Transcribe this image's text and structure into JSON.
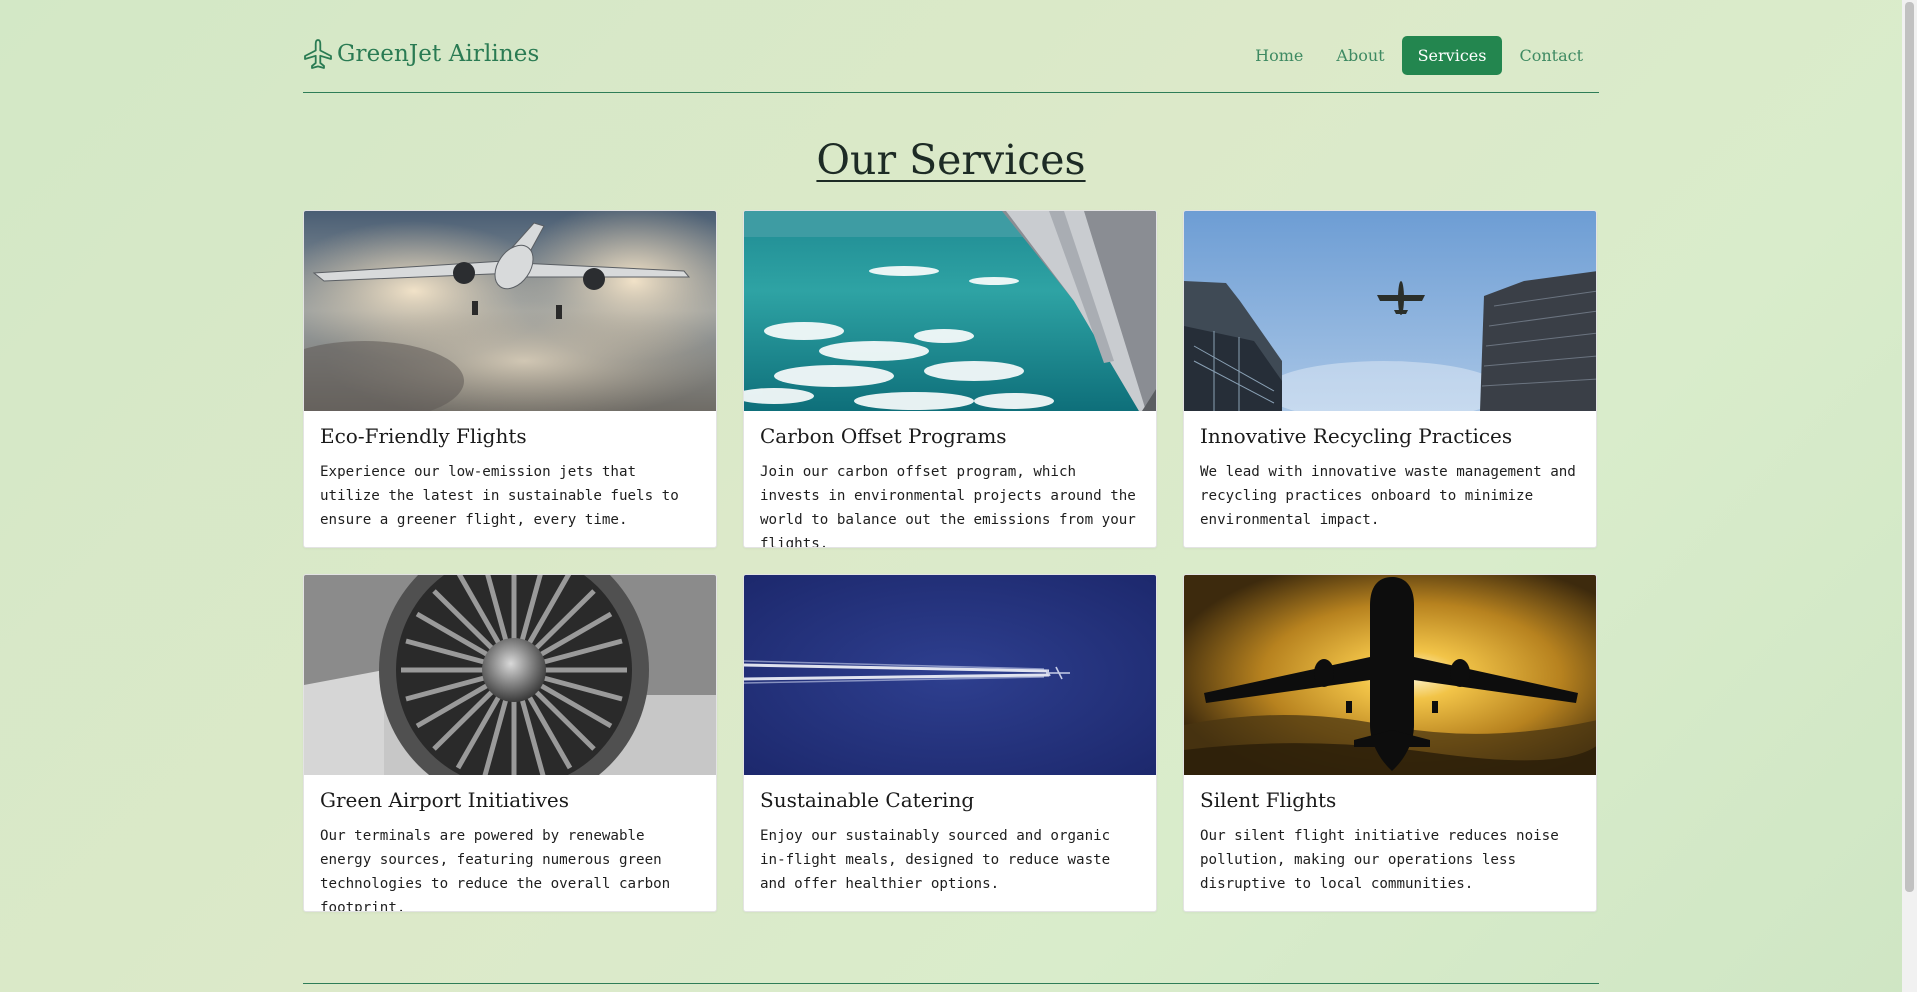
{
  "brand": {
    "name": "GreenJet Airlines",
    "icon": "plane-icon",
    "color": "#2a7b53"
  },
  "nav": {
    "items": [
      {
        "label": "Home",
        "active": false
      },
      {
        "label": "About",
        "active": false
      },
      {
        "label": "Services",
        "active": true
      },
      {
        "label": "Contact",
        "active": false
      }
    ],
    "active_color": "#23864f"
  },
  "main": {
    "title": "Our Services",
    "services": [
      {
        "title": "Eco-Friendly Flights",
        "text": "Experience our low-emission jets that utilize the latest in sustainable fuels to ensure a greener flight, every time.",
        "image": "airplane-in-clouds-image"
      },
      {
        "title": "Carbon Offset Programs",
        "text": "Join our carbon offset program, which invests in environmental projects around the world to balance out the emissions from your flights.",
        "image": "wing-over-ocean-image"
      },
      {
        "title": "Innovative Recycling Practices",
        "text": "We lead with innovative waste management and recycling practices onboard to minimize environmental impact.",
        "image": "plane-between-buildings-image"
      },
      {
        "title": "Green Airport Initiatives",
        "text": "Our terminals are powered by renewable energy sources, featuring numerous green technologies to reduce the overall carbon footprint.",
        "image": "jet-engine-image"
      },
      {
        "title": "Sustainable Catering",
        "text": "Enjoy our sustainably sourced and organic in-flight meals, designed to reduce waste and offer healthier options.",
        "image": "contrail-sky-image"
      },
      {
        "title": "Silent Flights",
        "text": "Our silent flight initiative reduces noise pollution, making our operations less disruptive to local communities.",
        "image": "plane-silhouette-sunset-image"
      }
    ]
  }
}
